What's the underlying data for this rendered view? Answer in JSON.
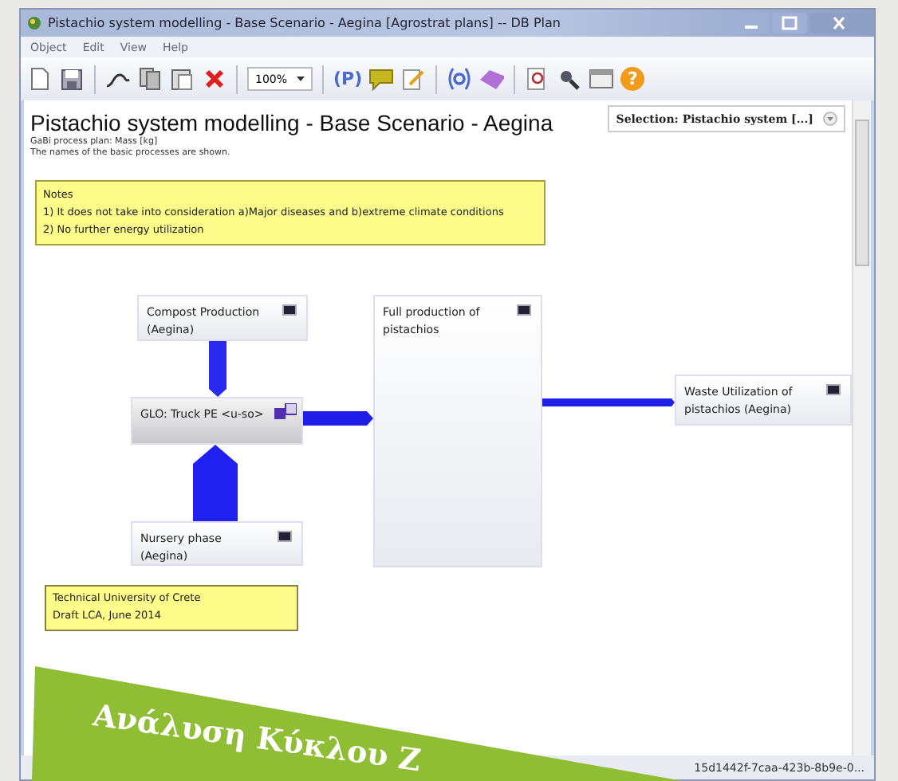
{
  "window": {
    "title": "Pistachio system modelling - Base Scenario - Aegina [Agrostrat plans] -- DB Plan"
  },
  "menu": [
    {
      "label": "Object"
    },
    {
      "label": "Edit"
    },
    {
      "label": "View"
    },
    {
      "label": "Help"
    }
  ],
  "toolbar": {
    "zoom": "100%",
    "plan_label": "(P)",
    "help_label": "?"
  },
  "plan": {
    "title": "Pistachio system modelling - Base Scenario - Aegina",
    "subtitle": "GaBi process plan: Mass [kg]",
    "description": "The names of the basic processes are shown.",
    "selection": "Selection: Pistachio system  [...]"
  },
  "notes": {
    "heading": "Notes",
    "lines": [
      "1) It does not take into consideration a)Major diseases and b)extreme climate conditions",
      "2) No further energy utilization"
    ]
  },
  "processes": [
    {
      "label": "Compost Production (Aegina)",
      "kind": "process"
    },
    {
      "label": "GLO: Truck PE <u-so>",
      "kind": "transport"
    },
    {
      "label": "Nursery phase (Aegina)",
      "kind": "process"
    },
    {
      "label": "Full production of pistachios",
      "kind": "process"
    },
    {
      "label": "Waste Utilization of pistachios (Aegina)",
      "kind": "process"
    }
  ],
  "footer_note": {
    "lines": [
      "Technical University of Crete",
      "Draft LCA, June 2014"
    ]
  },
  "status_bar": {
    "text": "15d1442f-7caa-423b-8b9e-0..."
  },
  "banner": {
    "text": "Ανάλυση Κύκλου Ζ"
  }
}
